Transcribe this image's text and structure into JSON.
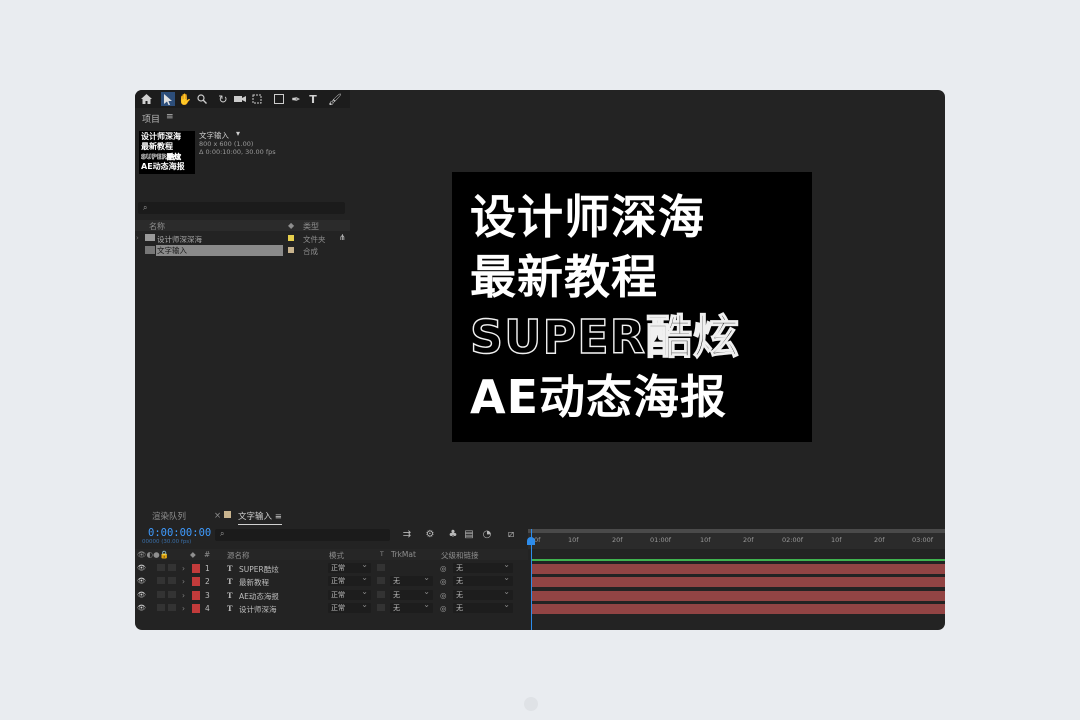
{
  "project": {
    "panel_title": "项目",
    "panel_menu": "≡",
    "comp_name": "文字输入",
    "comp_size": "800 x 600 (1.00)",
    "comp_duration": "Δ 0:00:10:00, 30.00 fps",
    "thumb_lines": [
      "设计师深海",
      "最新教程",
      "SUPER酷炫",
      "AE动态海报"
    ],
    "search_placeholder": "",
    "columns": {
      "name": "名称",
      "type": "类型"
    },
    "items": [
      {
        "name": "设计师深深海",
        "type": "文件夹",
        "color": "#e6cf4c"
      },
      {
        "name": "文字输入",
        "type": "合成",
        "color": "#c9b48e"
      }
    ]
  },
  "viewer": {
    "lines": [
      "设计师深海",
      "最新教程",
      "SUPER",
      "酷炫",
      "AE动态海报"
    ]
  },
  "timeline": {
    "tabs": [
      "渲染队列",
      "文字输入"
    ],
    "tab_close": "×",
    "tab_menu": "≡",
    "timecode": "0:00:00:00",
    "timecode_sub": "00000 (30.00 fps)",
    "ruler_ticks": [
      "0f",
      "10f",
      "20f",
      "01:00f",
      "10f",
      "20f",
      "02:00f",
      "10f",
      "20f",
      "03:00f"
    ],
    "columns": {
      "num": "#",
      "source_name": "源名称",
      "mode": "模式",
      "t": "T",
      "trkmat": "TrkMat",
      "parent": "父级和链接"
    },
    "layers": [
      {
        "num": "1",
        "name": "SUPER酷炫",
        "mode": "正常",
        "trkmat": "",
        "parent": "无"
      },
      {
        "num": "2",
        "name": "最新教程",
        "mode": "正常",
        "trkmat": "无",
        "parent": "无"
      },
      {
        "num": "3",
        "name": "AE动态海报",
        "mode": "正常",
        "trkmat": "无",
        "parent": "无"
      },
      {
        "num": "4",
        "name": "设计师深海",
        "mode": "正常",
        "trkmat": "无",
        "parent": "无"
      }
    ],
    "colors": {
      "playhead": "#2d8ceb",
      "layer_bar": "#924444",
      "label": "#c23b3b",
      "work_area": "#3fb34f"
    }
  }
}
